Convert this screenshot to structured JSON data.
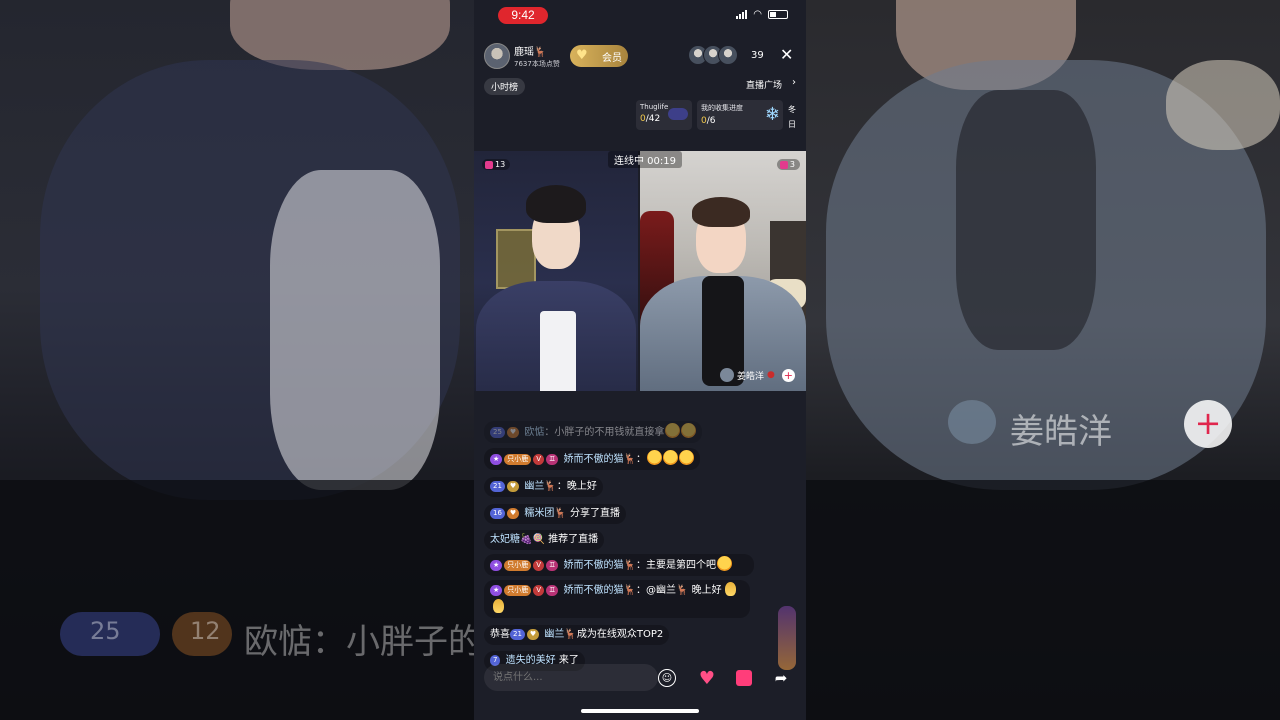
{
  "status_bar": {
    "time": "9:42"
  },
  "host": {
    "name": "鹿瑶🦌",
    "likes": "7637本场点赞",
    "member_label": "会员"
  },
  "viewer_count": "39",
  "nav": {
    "hour_rank": "小时榜",
    "plaza": "直播广场"
  },
  "tasks": [
    {
      "title": "Thuglife",
      "progress_current": "0",
      "progress_total": "/42"
    },
    {
      "title": "我的收集进度",
      "progress_current": "0",
      "progress_total": "/6"
    }
  ],
  "task_side": {
    "line1": "冬",
    "line2": "日"
  },
  "pk": {
    "status": "连线中 00:19",
    "left_rank": "13",
    "right_rank": "3",
    "guest_name": "姜皓洋"
  },
  "chat": [
    {
      "level": "25",
      "name": "欧惦",
      "text": "：小胖子的不用钱就直接拿"
    },
    {
      "badge": "只小鹿",
      "name": "娇而不傲的猫🦌",
      "text": "："
    },
    {
      "level": "21",
      "name": "幽兰🦌",
      "text": "：晚上好"
    },
    {
      "level": "16",
      "name": "糯米团🦌",
      "text": " 分享了直播"
    },
    {
      "name": "太妃糖🍇🍭",
      "text": " 推荐了直播"
    },
    {
      "badge": "只小鹿",
      "name": "娇而不傲的猫🦌",
      "text": "：主要是第四个吧"
    },
    {
      "badge": "只小鹿",
      "name": "娇而不傲的猫🦌",
      "text": "：@幽兰🦌 晚上好"
    },
    {
      "prefix": "恭喜",
      "level": "21",
      "name": "幽兰🦌",
      "text": "成为在线观众TOP2"
    },
    {
      "level": "7",
      "name": "遗失的美好",
      "text": " 来了"
    }
  ],
  "input": {
    "placeholder": "说点什么..."
  },
  "backdrop": {
    "big_name": "姜皓洋",
    "big_chat": "欧惦：小胖子的不用钱就直接拿",
    "big_level_a": "25",
    "big_level_b": "12"
  },
  "icons": [
    "signal-icon",
    "wifi-icon",
    "battery-icon",
    "close-icon",
    "chevron-right-icon",
    "emoji-icon",
    "heart-gift-icon",
    "gift-box-icon",
    "share-icon"
  ]
}
